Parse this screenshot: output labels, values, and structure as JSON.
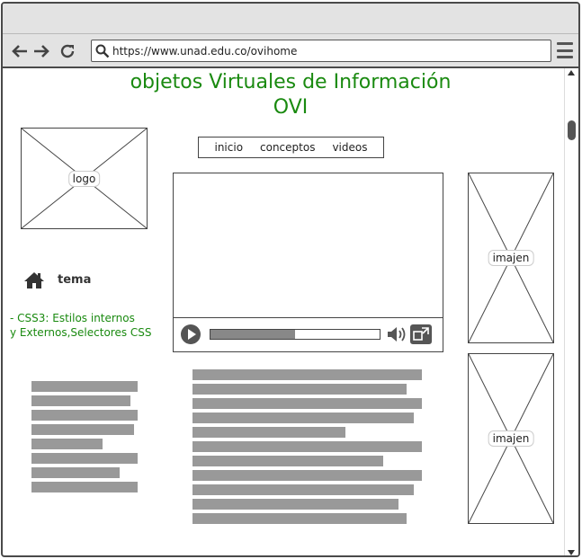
{
  "browser": {
    "url": "https://www.unad.edu.co/ovihome",
    "icons": [
      "back-icon",
      "forward-icon",
      "reload-icon",
      "search-icon",
      "menu-icon"
    ]
  },
  "page": {
    "title_line1": "objetos Virtuales de Información",
    "title_line2": "OVI",
    "logo_label": "logo",
    "nav": [
      "inicio",
      "conceptos",
      "videos"
    ],
    "image_label_top": "imajen",
    "image_label_bottom": "imajen",
    "tema_label": "tema",
    "topic_text": "- CSS3: Estilos internos\ny Externos,Selectores CSS",
    "video_progress_percent": 50
  },
  "colors": {
    "title": "#1a8a10",
    "topic": "#1a8a10",
    "text_placeholder": "#999999"
  }
}
